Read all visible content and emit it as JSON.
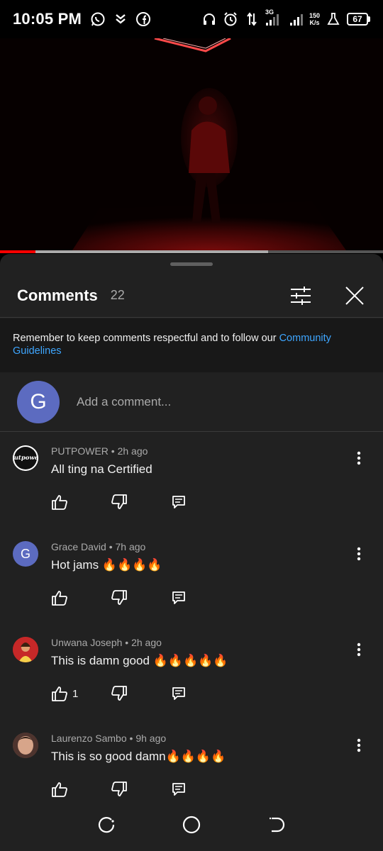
{
  "status_bar": {
    "time": "10:05 PM",
    "network_type": "3G",
    "speed_value": "150",
    "speed_unit": "K/s",
    "battery": "67",
    "left_icons": [
      "whatsapp-icon",
      "app-icon",
      "facebook-icon"
    ],
    "right_icons": [
      "headphones-icon",
      "alarm-icon",
      "data-arrows-icon",
      "signal-icon",
      "flask-icon"
    ]
  },
  "video": {
    "progress_fraction": 0.093,
    "buffered_fraction": 0.7,
    "progress_color": "#ff0000"
  },
  "sheet": {
    "title": "Comments",
    "count": "22",
    "guidelines_text": "Remember to keep comments respectful and to follow our ",
    "guidelines_link": "Community Guidelines",
    "user_initial": "G",
    "add_placeholder": "Add a comment...",
    "user_avatar_color": "#5c6bc0"
  },
  "comments": [
    {
      "author": "PUTPOWER",
      "age": "2h ago",
      "text": "All ting na Certified",
      "likes": "",
      "avatar": "putpower-logo"
    },
    {
      "author": "Grace David",
      "age": "7h ago",
      "text": "Hot jams 🔥🔥🔥🔥",
      "likes": "",
      "avatar": "G"
    },
    {
      "author": "Unwana Joseph",
      "age": "2h ago",
      "text": "This is damn good 🔥🔥🔥🔥🔥",
      "likes": "1",
      "avatar": "photo"
    },
    {
      "author": "Laurenzo Sambo",
      "age": "9h ago",
      "text": "This is so good damn🔥🔥🔥🔥",
      "likes": "",
      "avatar": "photo"
    }
  ],
  "avatar_texts": {
    "putpower_logo": "Putpower"
  }
}
